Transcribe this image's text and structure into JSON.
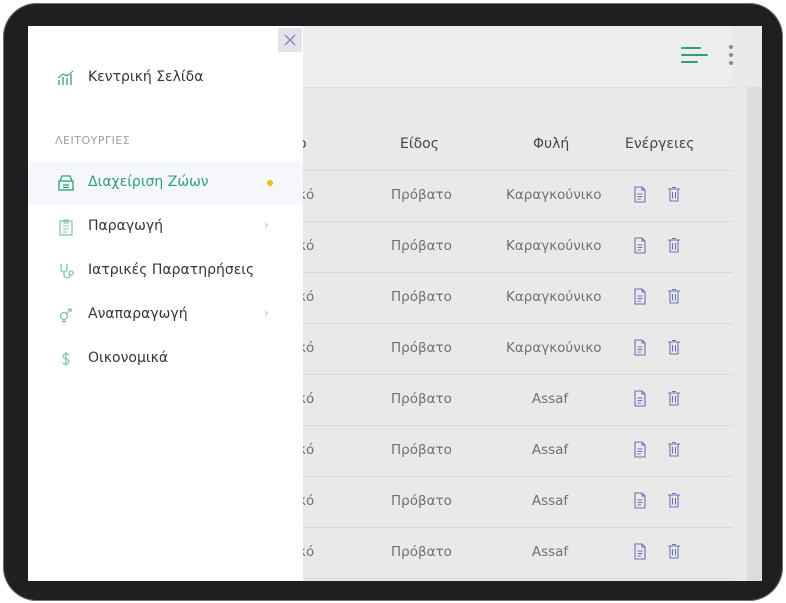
{
  "sidebar": {
    "home_label": "Κεντρική Σελίδα",
    "section_label": "ΛΕΙΤΟΥΡΓΙΕΣ",
    "items": [
      {
        "label": "Διαχείριση Ζώων",
        "icon": "inventory-icon"
      },
      {
        "label": "Παραγωγή",
        "icon": "clipboard-icon"
      },
      {
        "label": "Ιατρικές Παρατηρήσεις",
        "icon": "stethoscope-icon"
      },
      {
        "label": "Αναπαραγωγή",
        "icon": "gender-icon"
      },
      {
        "label": "Οικονομικά",
        "icon": "dollar-icon"
      }
    ]
  },
  "table": {
    "partial_header": "ο",
    "headers": {
      "species": "Είδος",
      "breed": "Φυλή",
      "actions": "Ενέργειες"
    },
    "rows": [
      {
        "partial": "κό",
        "species": "Πρόβατο",
        "breed": "Καραγκούνικο"
      },
      {
        "partial": "κό",
        "species": "Πρόβατο",
        "breed": "Καραγκούνικο"
      },
      {
        "partial": "κό",
        "species": "Πρόβατο",
        "breed": "Καραγκούνικο"
      },
      {
        "partial": "κό",
        "species": "Πρόβατο",
        "breed": "Καραγκούνικο"
      },
      {
        "partial": "κό",
        "species": "Πρόβατο",
        "breed": "Assaf"
      },
      {
        "partial": "κό",
        "species": "Πρόβατο",
        "breed": "Assaf"
      },
      {
        "partial": "κό",
        "species": "Πρόβατο",
        "breed": "Assaf"
      },
      {
        "partial": "κό",
        "species": "Πρόβατο",
        "breed": "Assaf"
      }
    ]
  },
  "colors": {
    "accent": "#2f9f76",
    "dot": "#f3b71f",
    "icon": "#6b72b4"
  }
}
